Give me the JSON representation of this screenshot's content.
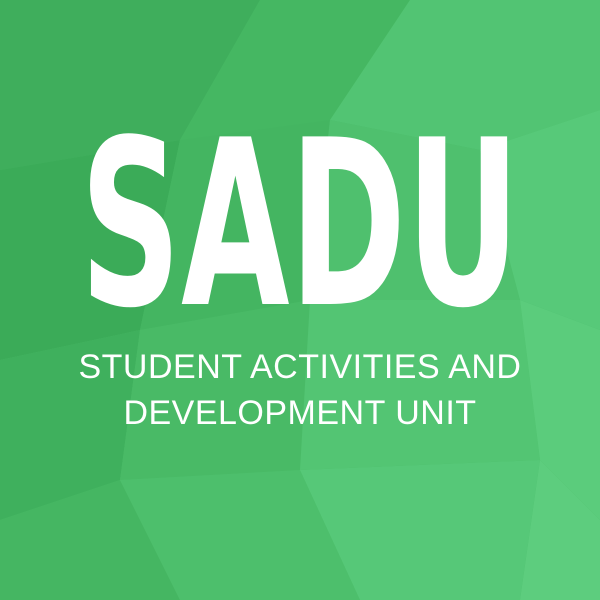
{
  "logo": {
    "acronym": "SADU"
  },
  "subtitle": {
    "line1": "STUDENT ACTIVITIES AND",
    "line2": "DEVELOPMENT UNIT"
  },
  "colors": {
    "background": "#4cbb68",
    "text": "#ffffff"
  }
}
